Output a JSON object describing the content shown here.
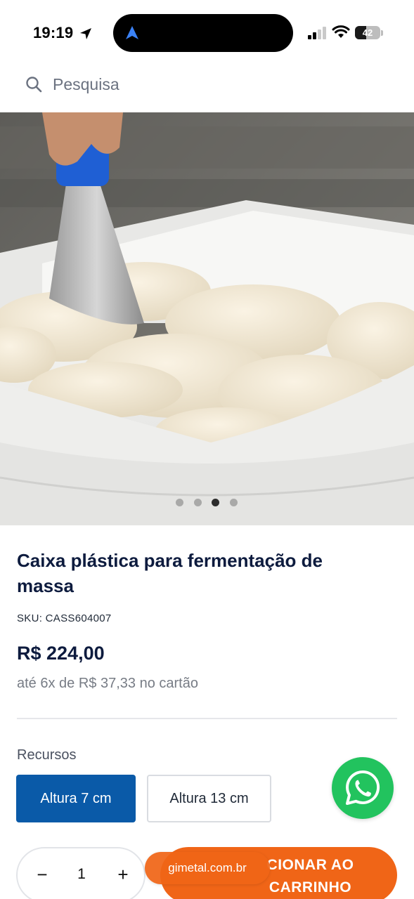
{
  "status_bar": {
    "time": "19:19",
    "battery": "42"
  },
  "search": {
    "placeholder": "Pesquisa"
  },
  "gallery": {
    "image_count": 4,
    "active_index": 2
  },
  "product": {
    "title": "Caixa plástica para fermentação de massa",
    "sku": "SKU: CASS604007",
    "price": "R$ 224,00",
    "installments": "até 6x de R$ 37,33  no cartão"
  },
  "resources": {
    "label": "Recursos",
    "options": [
      "Altura 7 cm",
      "Altura 13 cm"
    ],
    "selected_index": 0
  },
  "cart": {
    "quantity": "1",
    "minus": "−",
    "plus": "+",
    "add_label": "ADICIONAR AO CARRINHO",
    "add_label_visible_line1": "CIONAR AO",
    "add_label_visible_line2": "CARRINHO"
  },
  "browser": {
    "url": "gimetal.com.br"
  },
  "colors": {
    "primary_blue": "#0a5aa8",
    "accent_orange": "#f06517",
    "whatsapp_green": "#22c35e",
    "title_navy": "#0d1b3e"
  },
  "icons": [
    "location-arrow-icon",
    "navigation-icon",
    "signal-icon",
    "wifi-icon",
    "battery-icon",
    "search-icon",
    "whatsapp-icon"
  ]
}
